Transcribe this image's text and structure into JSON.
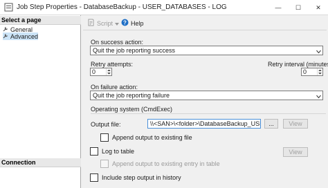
{
  "window": {
    "title": "Job Step Properties - DatabaseBackup - USER_DATABASES - LOG",
    "controls": {
      "minimize": "—",
      "maximize": "☐",
      "close": "✕"
    }
  },
  "left_pane": {
    "select_page_header": "Select a page",
    "pages": [
      {
        "label": "General",
        "icon": "wrench-icon",
        "selected": false
      },
      {
        "label": "Advanced",
        "icon": "wrench-icon",
        "selected": true
      }
    ],
    "connection_header": "Connection"
  },
  "toolbar": {
    "script_label": "Script",
    "help_label": "Help"
  },
  "form": {
    "on_success": {
      "label": "On success action:",
      "value": "Quit the job reporting success"
    },
    "retry_attempts": {
      "label": "Retry attempts:",
      "value": "0"
    },
    "retry_interval": {
      "label": "Retry interval (minutes):",
      "value": "0"
    },
    "on_failure": {
      "label": "On failure action:",
      "value": "Quit the job reporting failure"
    },
    "os_section_label": "Operating system (CmdExec)",
    "output_file": {
      "label": "Output file:",
      "value": "\\\\<SAN>\\<folder>\\DatabaseBackup_USER_LC",
      "browse_label": "...",
      "view_label": "View"
    },
    "append_output": {
      "label": "Append output to existing file",
      "checked": false
    },
    "log_to_table": {
      "label": "Log to table",
      "checked": false,
      "view_label": "View"
    },
    "append_table": {
      "label": "Append output to existing entry in table",
      "checked": false,
      "enabled": false
    },
    "include_history": {
      "label": "Include step output in history",
      "checked": false
    }
  },
  "colors": {
    "accent_blue": "#4a90d9",
    "selection": "#cce4f7",
    "window_bg": "#f0f0f0"
  }
}
